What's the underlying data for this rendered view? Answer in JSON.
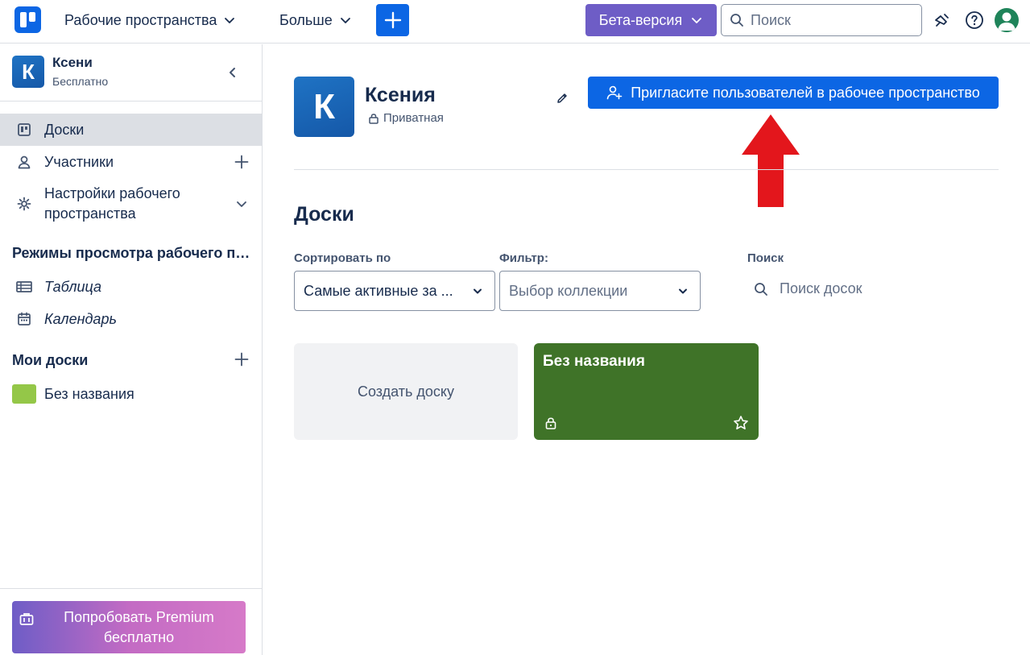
{
  "topbar": {
    "workspaces_label": "Рабочие пространства",
    "more_label": "Больше",
    "beta_label": "Бета-версия",
    "search_placeholder": "Поиск"
  },
  "sidebar": {
    "workspace_initial": "К",
    "workspace_name": "Ксени",
    "workspace_plan": "Бесплатно",
    "items": [
      {
        "label": "Доски",
        "icon": "board-icon",
        "active": true
      },
      {
        "label": "Участники",
        "icon": "person-icon"
      },
      {
        "label": "Настройки рабочего\nпространства",
        "icon": "gear-icon"
      }
    ],
    "views_heading": "Режимы просмотра рабочего пространства",
    "views": [
      {
        "label": "Таблица",
        "icon": "table-icon"
      },
      {
        "label": "Календарь",
        "icon": "calendar-icon"
      }
    ],
    "my_boards_heading": "Мои доски",
    "boards": [
      {
        "label": "Без названия",
        "color": "#94c748"
      }
    ],
    "premium_label": "Попробовать Premium бесплатно"
  },
  "main": {
    "workspace_initial": "К",
    "workspace_name": "Ксения",
    "visibility": "Приватная",
    "invite_label": "Пригласите пользователей в рабочее пространство",
    "boards_title": "Доски",
    "sort_label": "Сортировать по",
    "sort_value": "Самые активные за ...",
    "filter_label": "Фильтр:",
    "filter_placeholder": "Выбор коллекции",
    "search_label": "Поиск",
    "search_placeholder": "Поиск досок",
    "create_board_label": "Создать доску",
    "board_title": "Без названия",
    "board_color": "#3f7328"
  },
  "colors": {
    "primary": "#0c66e4",
    "beta": "#6e5dc6",
    "annotation_arrow": "#e3161c"
  }
}
